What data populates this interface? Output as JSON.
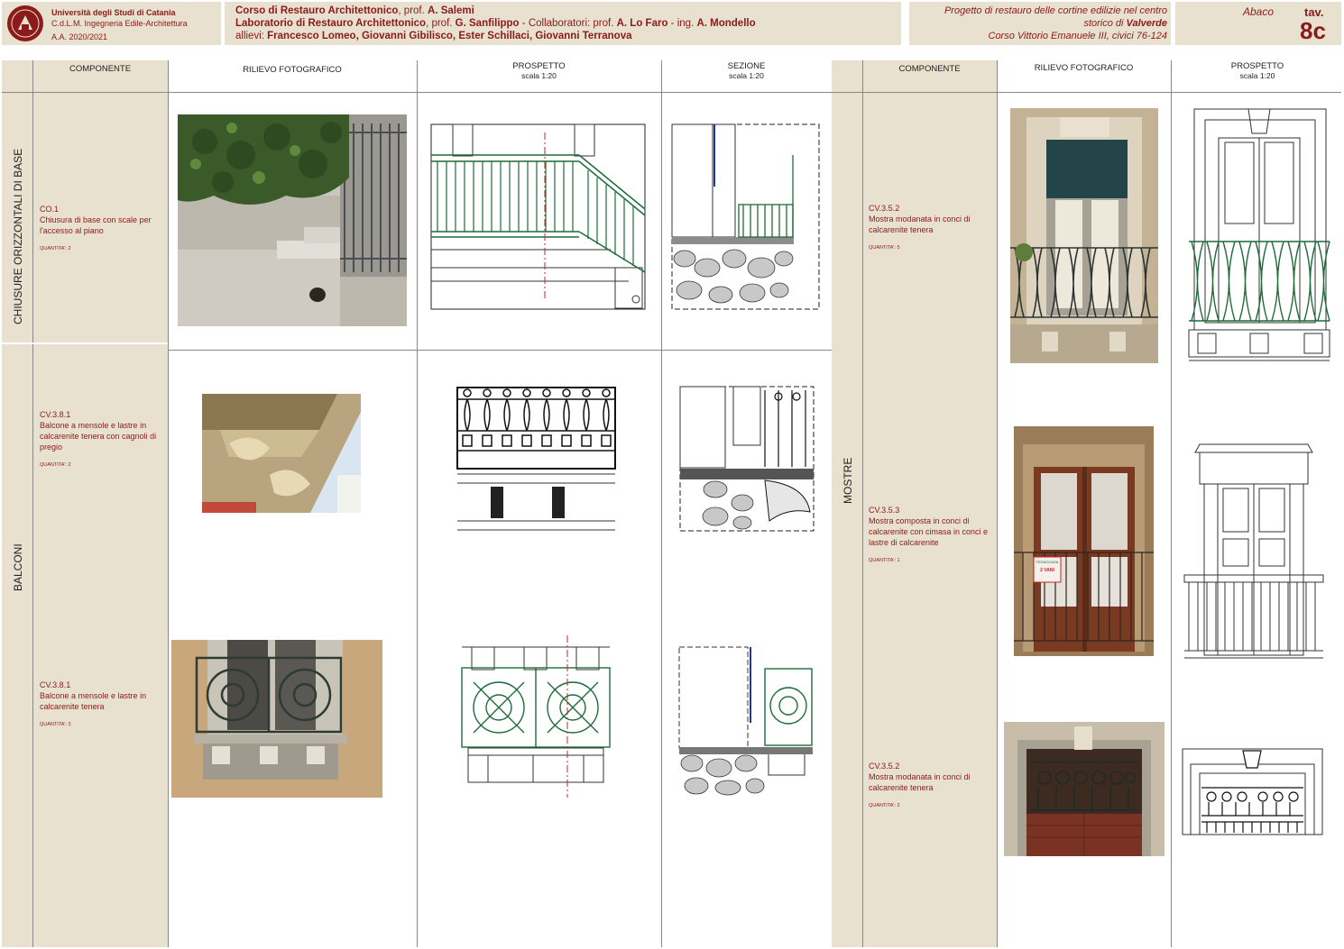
{
  "header": {
    "university": "Università degli Studi di Catania",
    "course_degree": "C.d.L.M. Ingegneria Edile-Architettura",
    "year": "A.A. 2020/2021",
    "line1_pre": "Corso di Restauro Architettonico",
    "line1_mid": ", prof. ",
    "line1_prof": "A. Salemi",
    "line2_pre": "Laboratorio di Restauro Architettonico",
    "line2_mid": ", prof. ",
    "line2_prof": "G. Sanfilippo",
    "line2_collab": " - Collaboratori: prof. ",
    "line2_c1": "A. Lo Faro",
    "line2_ing": " - ing. ",
    "line2_c2": "A. Mondello",
    "line3_label": "allievi:  ",
    "line3_students": "Francesco Lomeo, Giovanni Gibilisco, Ester Schillaci, Giovanni Terranova",
    "project_line1": "Progetto di restauro delle cortine edilizie nel centro",
    "project_line2_pre": "storico di ",
    "project_line2_place": "Valverde",
    "project_line3": "Corso Vittorio Emanuele III, civici 76-124",
    "abaco": "Abaco",
    "tav_label": "tav.",
    "tav_number": "8c"
  },
  "columns": {
    "componente": "COMPONENTE",
    "rilievo": "RILIEVO FOTOGRAFICO",
    "prospetto": "PROSPETTO",
    "sezione": "SEZIONE",
    "scala": "scala 1:20"
  },
  "sections": {
    "chiusure": "CHIUSURE ORIZZONTALI DI BASE",
    "balconi": "BALCONI",
    "mostre": "MOSTRE"
  },
  "components": [
    {
      "code": "CO.1",
      "desc": "Chiusura di base con scale per l'accesso al piano",
      "qty": "QUANTITA': 2"
    },
    {
      "code": "CV.3.8.1",
      "desc": "Balcone a mensole e lastre in calcarenite tenera con cagnoli di pregio",
      "qty": "QUANTITA': 2"
    },
    {
      "code": "CV.3.8.1",
      "desc": "Balcone a mensole e lastre in calcarenite tenera",
      "qty": "QUANTITA': 3"
    },
    {
      "code": "CV.3.5.2",
      "desc": "Mostra modanata in conci di calcarenite tenera",
      "qty": "QUANTITA': 5"
    },
    {
      "code": "CV.3.5.3",
      "desc": "Mostra composta in conci di calcarenite con cimasa in conci e lastre di calcarenite",
      "qty": "QUANTITA': 1"
    },
    {
      "code": "CV.3.5.2",
      "desc": "Mostra modanata in conci di calcarenite tenera",
      "qty": "QUANTITA': 2"
    }
  ],
  "photo_texts": {
    "sign_line1": "TECNOCASA",
    "sign_line2": "2 VANI"
  },
  "colors": {
    "cream": "#e9e1cf",
    "dark_red": "#8b1a1a",
    "railing_green": "#1f6b3a"
  }
}
